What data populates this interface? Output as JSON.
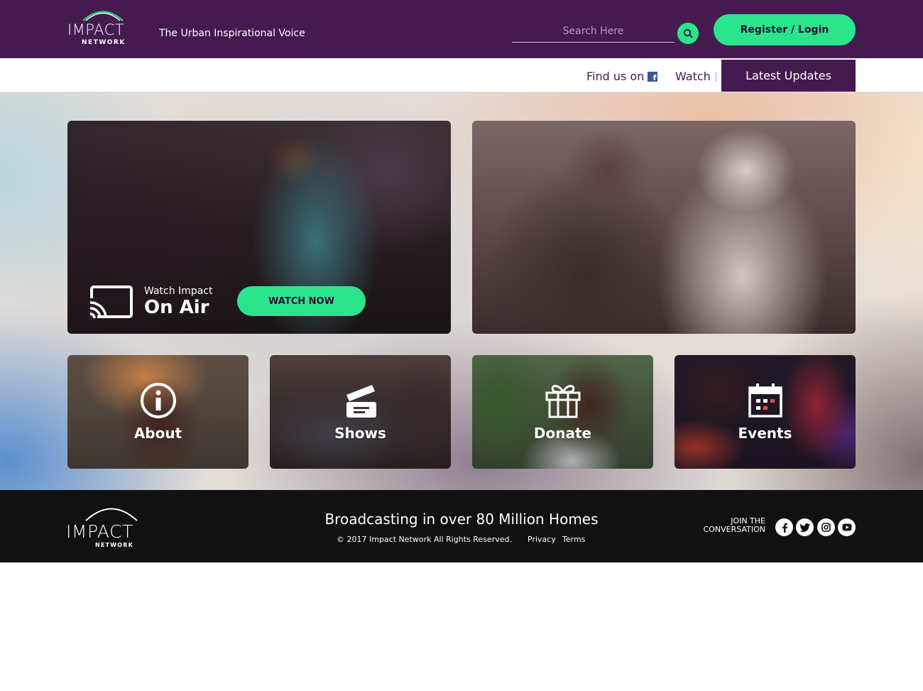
{
  "header": {
    "logo_text": "IMPACT",
    "logo_subtext": "NETWORK",
    "tagline": "The Urban Inspirational Voice",
    "search_placeholder": "Search Here",
    "search_icon": "search-icon",
    "register_label": "Register / Login"
  },
  "subnav": {
    "find_us_label": "Find us on",
    "facebook_icon": "facebook-icon",
    "watch_label": "Watch",
    "latest_updates_label": "Latest Updates"
  },
  "hero": {
    "onair": {
      "cast_icon": "cast-icon",
      "small_label": "Watch Impact",
      "big_label": "On Air",
      "button_label": "WATCH NOW"
    },
    "tiles": [
      {
        "label": "About",
        "icon": "info-icon"
      },
      {
        "label": "Shows",
        "icon": "clapperboard-icon"
      },
      {
        "label": "Donate",
        "icon": "gift-icon"
      },
      {
        "label": "Events",
        "icon": "calendar-icon"
      }
    ]
  },
  "footer": {
    "logo_text": "IMPACT",
    "logo_subtext": "NETWORK",
    "headline": "Broadcasting in over 80 Million Homes",
    "copyright": "© 2017 Impact Network All Rights Reserved.",
    "privacy_label": "Privacy",
    "terms_label": "Terms",
    "join_line1": "JOIN THE",
    "join_line2": "CONVERSATION",
    "social_icons": [
      "facebook-icon",
      "twitter-icon",
      "instagram-icon",
      "youtube-icon"
    ]
  },
  "colors": {
    "brand_purple": "#451a4e",
    "accent_green": "#2ae58c",
    "footer_black": "#111111"
  }
}
